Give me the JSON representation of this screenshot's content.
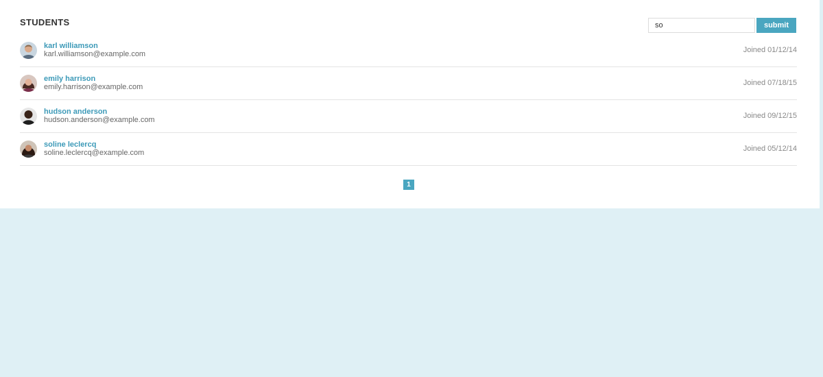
{
  "section": {
    "title": "STUDENTS"
  },
  "search": {
    "value": "so",
    "submit_label": "submit"
  },
  "students": [
    {
      "name": "karl williamson",
      "email": "karl.williamson@example.com",
      "joined": "Joined 01/12/14",
      "avatar_icon": "avatar-icon"
    },
    {
      "name": "emily harrison",
      "email": "emily.harrison@example.com",
      "joined": "Joined 07/18/15",
      "avatar_icon": "avatar-icon"
    },
    {
      "name": "hudson anderson",
      "email": "hudson.anderson@example.com",
      "joined": "Joined 09/12/15",
      "avatar_icon": "avatar-icon"
    },
    {
      "name": "soline leclercq",
      "email": "soline.leclercq@example.com",
      "joined": "Joined 05/12/14",
      "avatar_icon": "avatar-icon"
    }
  ],
  "pagination": {
    "current_page": "1"
  },
  "colors": {
    "accent": "#4aa6c0",
    "link": "#3d9ab8",
    "background": "#dff0f5"
  }
}
